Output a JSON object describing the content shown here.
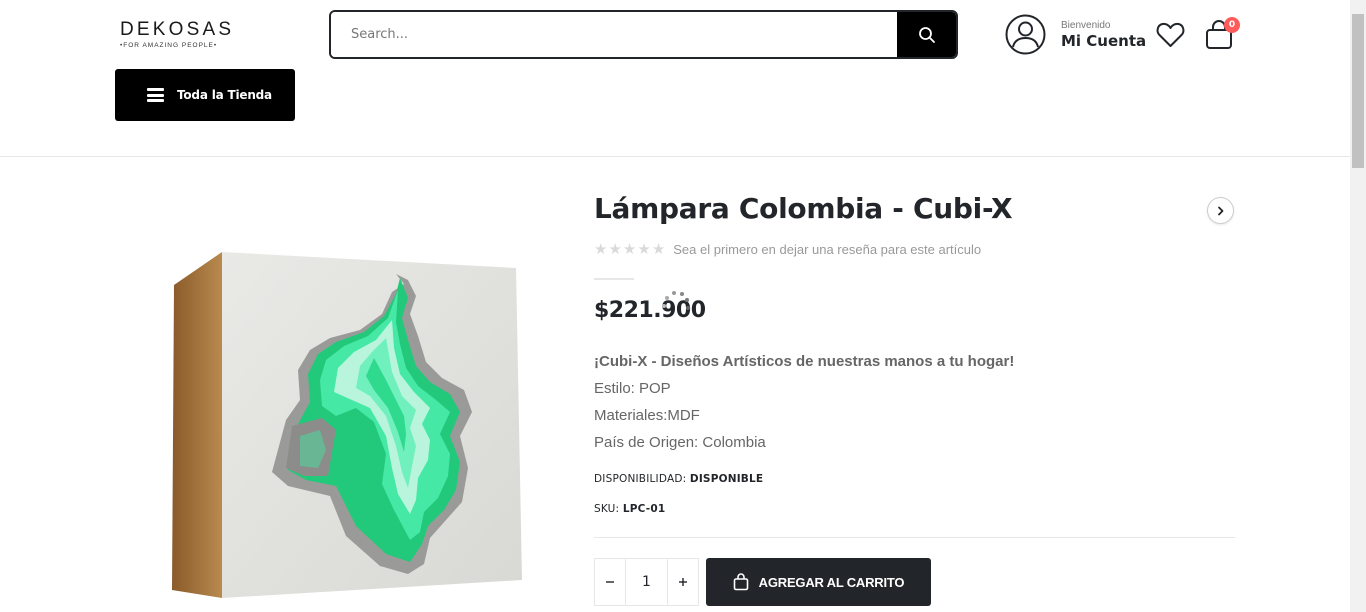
{
  "header": {
    "logo": {
      "name": "DEKOSAS",
      "tagline": "•FOR AMAZING PEOPLE•"
    },
    "search": {
      "placeholder": "Search..."
    },
    "account": {
      "welcome": "Bienvenido",
      "label": "Mi Cuenta"
    },
    "cart": {
      "count": "0"
    },
    "all_store_label": "Toda la Tienda"
  },
  "product": {
    "title": "Lámpara Colombia - Cubi-X",
    "rating": {
      "stars": 0,
      "max": 5,
      "review_text": "Sea el primero en dejar una reseña para este artículo"
    },
    "price": "$221.900",
    "description": {
      "lead": "¡Cubi-X - Diseños Artísticos de nuestras manos a tu hogar!",
      "lines": [
        "Estilo: POP",
        "Materiales:MDF",
        "País de Origen: Colombia"
      ]
    },
    "availability": {
      "label": "DISPONIBILIDAD:",
      "value": "DISPONIBLE"
    },
    "sku": {
      "label": "SKU:",
      "value": "LPC-01"
    },
    "quantity": "1",
    "add_to_cart_label": "AGREGAR AL CARRITO"
  },
  "colors": {
    "accent_dark": "#222529",
    "badge": "#ff5b5b",
    "lamp_glow": "#3ee8a0"
  }
}
